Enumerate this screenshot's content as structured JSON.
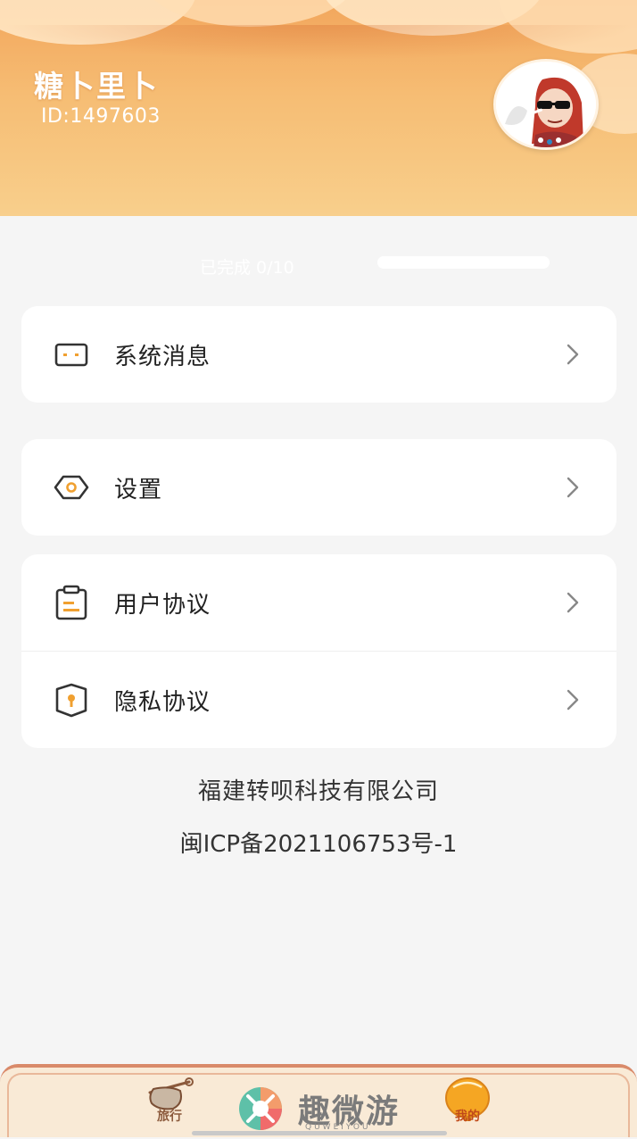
{
  "profile": {
    "username": "糖卜里卜",
    "user_id": "ID:1497603"
  },
  "progress": {
    "label": "已完成 0/10",
    "fraction": 0.0
  },
  "menu": {
    "system_messages": "系统消息",
    "settings": "设置",
    "user_agreement": "用户协议",
    "privacy_policy": "隐私协议"
  },
  "footer": {
    "company": "福建转呗科技有限公司",
    "icp": "闽ICP备2021106753号-1"
  },
  "tabbar": {
    "travel": "旅行",
    "mine": "我的"
  },
  "watermark": {
    "logo_text": "趣微游",
    "logo_sub": "QUWEIYOU"
  },
  "colors": {
    "header_orange": "#f6bd74",
    "icon_accent": "#f0a030",
    "icon_stroke": "#333333",
    "tab_border": "#d98a6a"
  },
  "icons": {
    "system_messages": "message-box-icon",
    "settings": "gear-hexagon-icon",
    "user_agreement": "clipboard-icon",
    "privacy_policy": "shield-icon",
    "chevron": "chevron-right-icon"
  }
}
